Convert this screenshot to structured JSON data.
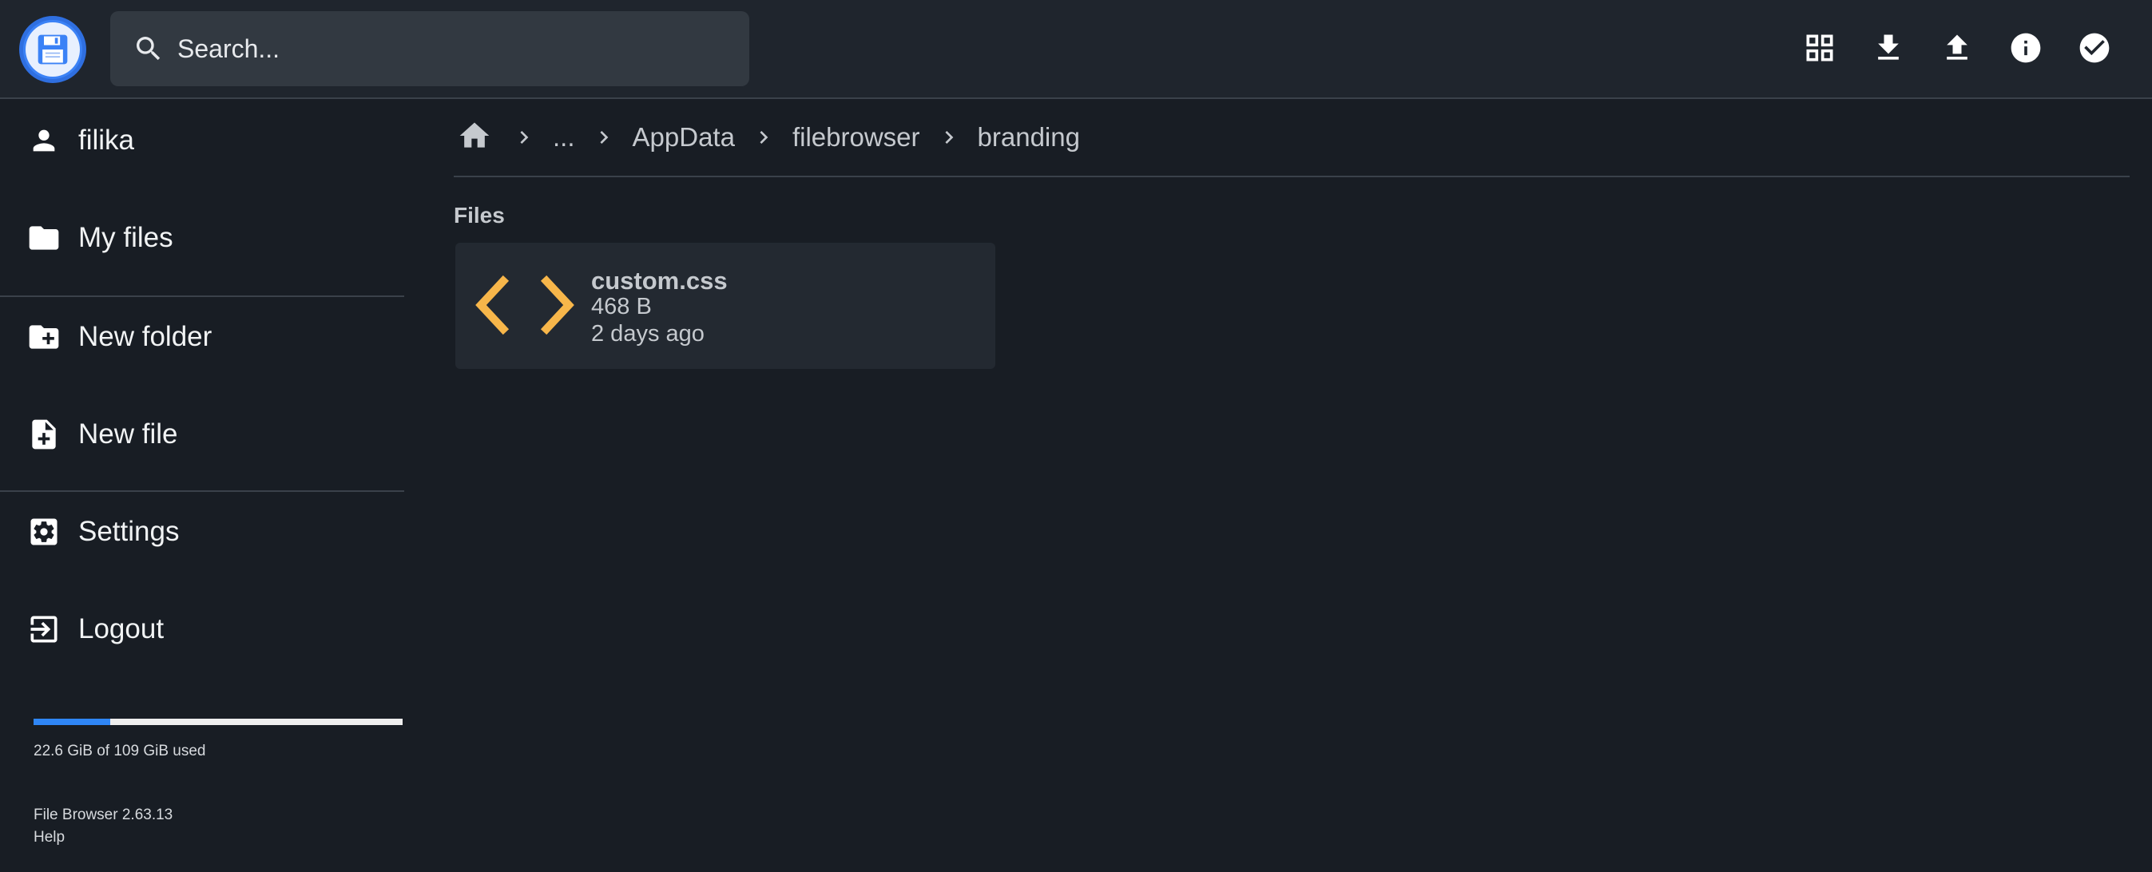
{
  "header": {
    "search_placeholder": "Search...",
    "actions": [
      "view-grid",
      "download",
      "upload",
      "info",
      "select"
    ]
  },
  "sidebar": {
    "user": "filika",
    "my_files": "My files",
    "new_folder": "New folder",
    "new_file": "New file",
    "settings": "Settings",
    "logout": "Logout",
    "usage_text": "22.6 GiB of 109 GiB used",
    "usage_fraction": 0.207,
    "version": "File Browser 2.63.13",
    "help": "Help"
  },
  "breadcrumb": {
    "items": [
      "...",
      "AppData",
      "filebrowser",
      "branding"
    ]
  },
  "main": {
    "section_title": "Files",
    "files": [
      {
        "name": "custom.css",
        "size": "468 B",
        "modified": "2 days ago",
        "icon": "code-icon"
      }
    ]
  },
  "colors": {
    "background": "#181d24",
    "header": "#1f252d",
    "accent": "#2f86f6",
    "code_icon": "#f7b64a"
  }
}
